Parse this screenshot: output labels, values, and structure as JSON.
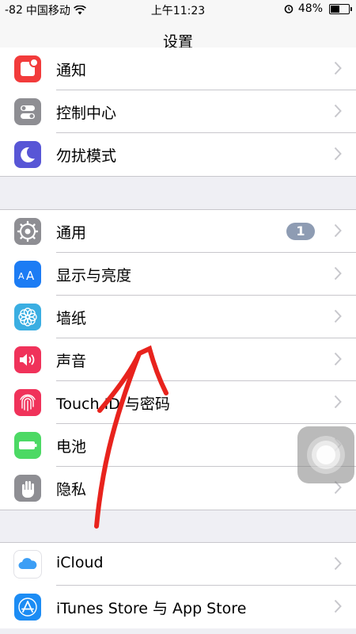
{
  "status_bar": {
    "signal": "-82",
    "carrier": "中国移动",
    "wifi_icon": "wifi-icon",
    "time": "上午11:23",
    "alarm_icon": "alarm-clock-icon",
    "battery_percent": "48%",
    "battery_level": 0.48
  },
  "nav": {
    "title": "设置"
  },
  "group1": [
    {
      "label": "通知",
      "icon": "notifications-icon",
      "color": "#f23b3b"
    },
    {
      "label": "控制中心",
      "icon": "control-center-icon",
      "color": "#8e8e93"
    },
    {
      "label": "勿扰模式",
      "icon": "moon-icon",
      "color": "#5856d6"
    }
  ],
  "group2": [
    {
      "label": "通用",
      "icon": "gear-icon",
      "color": "#8e8e93",
      "badge": "1"
    },
    {
      "label": "显示与亮度",
      "icon": "display-brightness-icon",
      "color": "#1c7cf4"
    },
    {
      "label": "墙纸",
      "icon": "wallpaper-flower-icon",
      "color": "#3aaee2"
    },
    {
      "label": "声音",
      "icon": "speaker-icon",
      "color": "#f0325a"
    },
    {
      "label": "Touch ID 与密码",
      "icon": "fingerprint-icon",
      "color": "#f0325a"
    },
    {
      "label": "电池",
      "icon": "battery-icon",
      "color": "#4cd964"
    },
    {
      "label": "隐私",
      "icon": "hand-icon",
      "color": "#8e8e93"
    }
  ],
  "group3": [
    {
      "label": "iCloud",
      "icon": "icloud-icon",
      "color": "#ffffff"
    },
    {
      "label": "iTunes Store 与 App Store",
      "icon": "app-store-icon",
      "color": "#1c8cf4"
    }
  ],
  "overlay": {
    "assistive_touch": "assistive-touch-button",
    "annotation": "red-arrow-annotation"
  }
}
